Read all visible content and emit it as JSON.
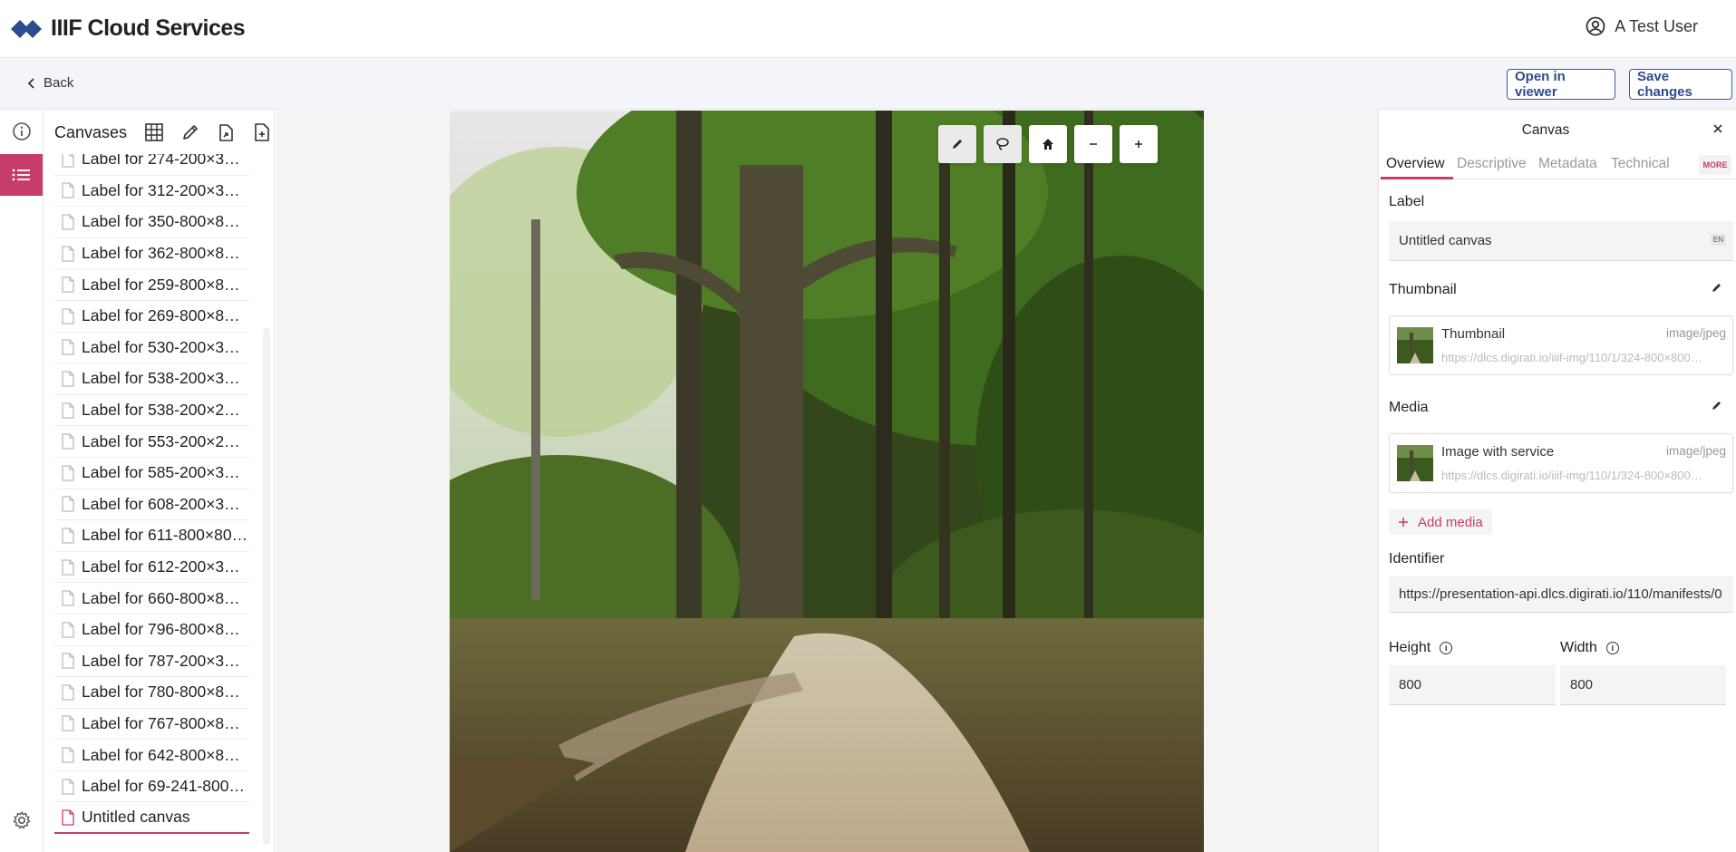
{
  "header": {
    "app_title": "IIIF Cloud Services",
    "user_name": "A Test User"
  },
  "subbar": {
    "back_label": "Back",
    "open_viewer_label": "Open in viewer",
    "save_label": "Save changes"
  },
  "canvas_list": {
    "title": "Canvases",
    "items": [
      "Label for 274-200×3…",
      "Label for 312-200×3…",
      "Label for 350-800×8…",
      "Label for 362-800×8…",
      "Label for 259-800×8…",
      "Label for 269-800×8…",
      "Label for 530-200×3…",
      "Label for 538-200×3…",
      "Label for 538-200×2…",
      "Label for 553-200×2…",
      "Label for 585-200×3…",
      "Label for 608-200×3…",
      "Label for 611-800×80…",
      "Label for 612-200×3…",
      "Label for 660-800×8…",
      "Label for 796-800×8…",
      "Label for 787-200×3…",
      "Label for 780-800×8…",
      "Label for 767-800×8…",
      "Label for 642-800×8…",
      "Label for 69-241-800…"
    ],
    "selected_item": "Untitled canvas"
  },
  "properties": {
    "title": "Canvas",
    "tabs": [
      "Overview",
      "Descriptive",
      "Metadata",
      "Technical"
    ],
    "more_label": "MORE",
    "label_section": "Label",
    "label_value": "Untitled canvas",
    "label_lang": "EN",
    "thumbnail_section": "Thumbnail",
    "thumbnail": {
      "name": "Thumbnail",
      "type": "image/jpeg",
      "url": "https://dlcs.digirati.io/iiif-img/110/1/324-800×800…"
    },
    "media_section": "Media",
    "media": {
      "name": "Image with service",
      "type": "image/jpeg",
      "url": "https://dlcs.digirati.io/iiif-img/110/1/324-800×800…"
    },
    "add_media_label": "Add media",
    "identifier_section": "Identifier",
    "identifier_value": "https://presentation-api.dlcs.digirati.io/110/manifests/0",
    "height_label": "Height",
    "height_value": "800",
    "width_label": "Width",
    "width_value": "800"
  }
}
